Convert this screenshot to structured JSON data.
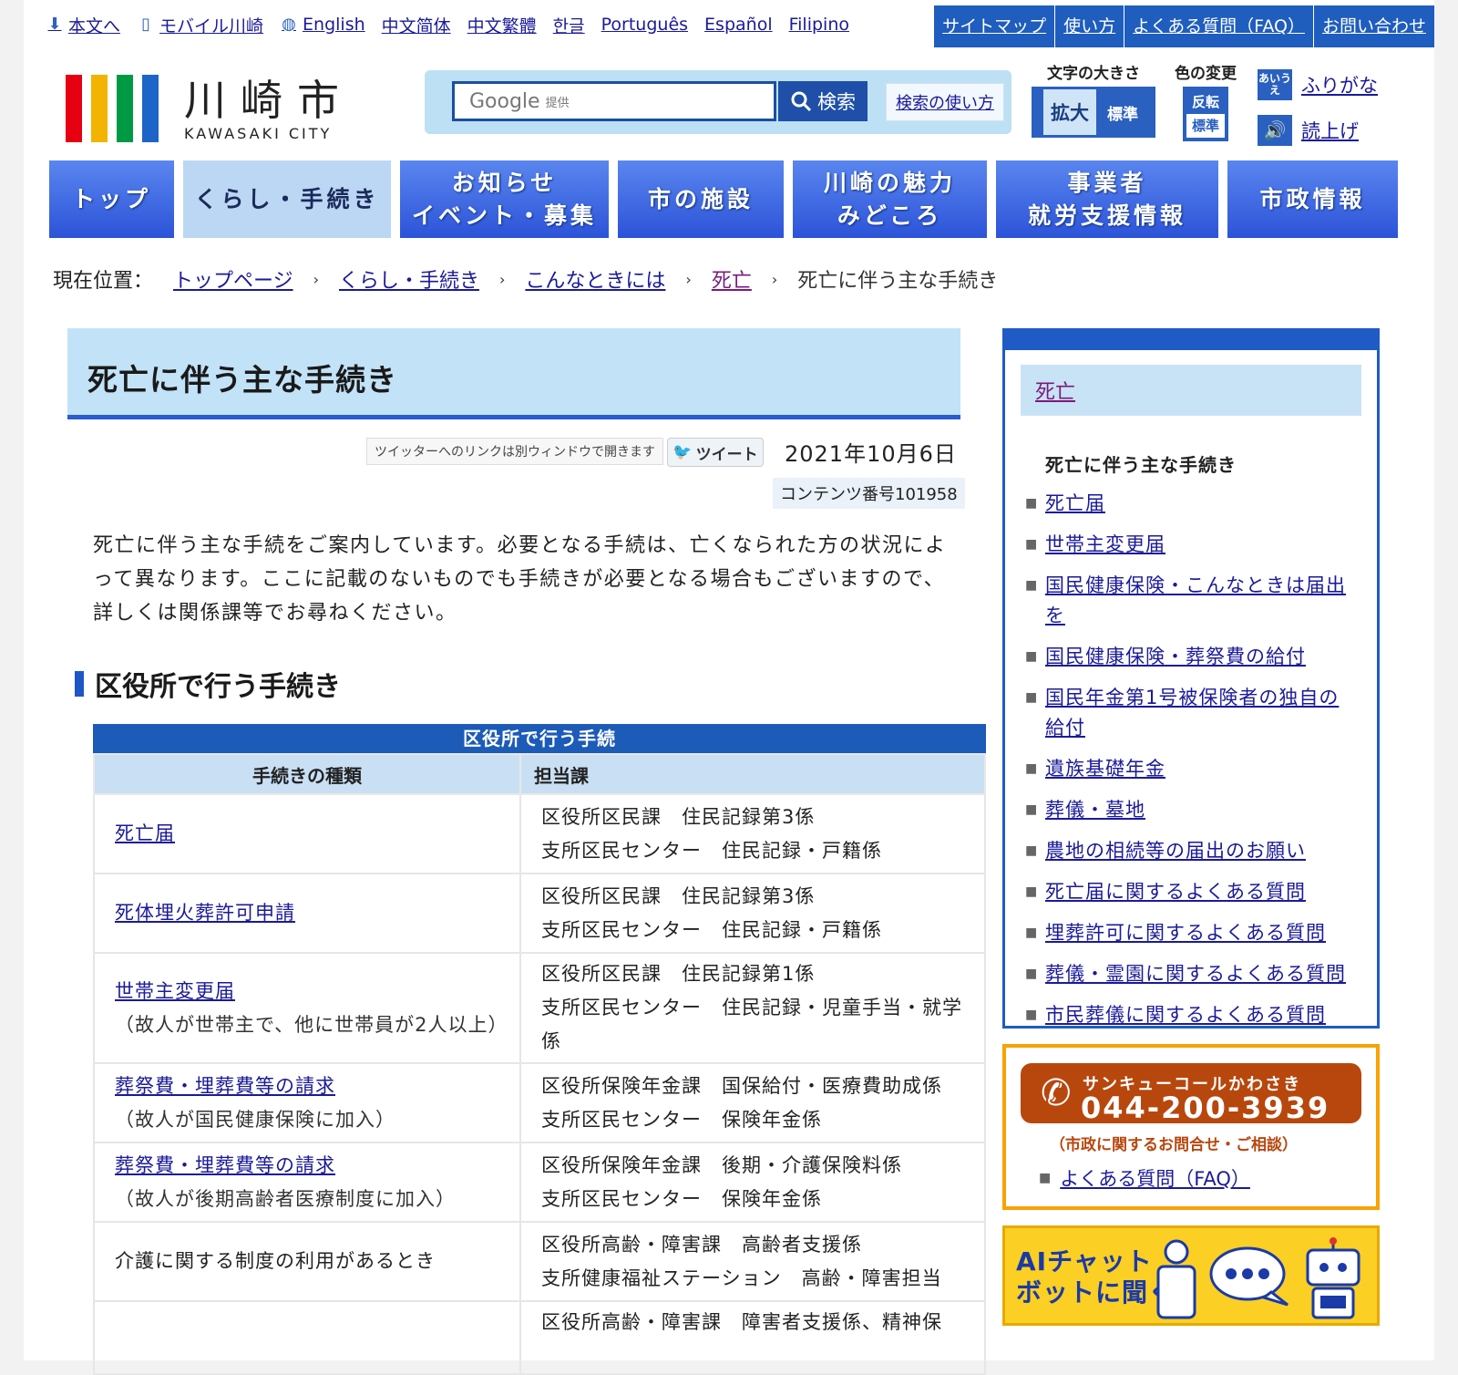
{
  "utility": {
    "items": [
      {
        "label": "本文へ",
        "icon": "download-arrow-icon"
      },
      {
        "label": "モバイル川崎",
        "icon": "mobile-icon"
      },
      {
        "label": "English",
        "icon": "globe-icon"
      },
      {
        "label": "中文简体"
      },
      {
        "label": "中文繁體"
      },
      {
        "label": "한글"
      },
      {
        "label": "Português"
      },
      {
        "label": "Español"
      },
      {
        "label": "Filipino"
      }
    ],
    "topnav": [
      "サイトマップ",
      "使い方",
      "よくある質問（FAQ）",
      "お問い合わせ"
    ]
  },
  "logo": {
    "jp": "川崎市",
    "en": "KAWASAKI CITY",
    "colors": [
      "#e60012",
      "#f2b400",
      "#009a44",
      "#1d64c8"
    ]
  },
  "search": {
    "google": "Google",
    "google_sub": "提供",
    "button": "検索",
    "help": "検索の使い方"
  },
  "accessibility": {
    "font_title": "文字の大きさ",
    "font_big": "拡大",
    "font_std": "標準",
    "color_title": "色の変更",
    "color_invert": "反転",
    "color_std": "標準",
    "ruby_icon": "あいうえ",
    "ruby": "ふりがな",
    "reader": "読上げ"
  },
  "globalnav": [
    {
      "label": "トップ"
    },
    {
      "label": "くらし・手続き",
      "active": true
    },
    {
      "label": "お知らせ\nイベント・募集"
    },
    {
      "label": "市の施設"
    },
    {
      "label": "川崎の魅力\nみどころ"
    },
    {
      "label": "事業者\n就労支援情報"
    },
    {
      "label": "市政情報"
    }
  ],
  "breadcrumb": {
    "prefix": "現在位置：",
    "links": [
      "トップページ",
      "くらし・手続き",
      "こんなときには",
      "死亡"
    ],
    "current": "死亡に伴う主な手続き"
  },
  "main": {
    "title": "死亡に伴う主な手続き",
    "tweet_note": "ツイッターへのリンクは別ウィンドウで開きます",
    "tweet_button": "ツイート",
    "date": "2021年10月6日",
    "content_no": "コンテンツ番号101958",
    "intro": "死亡に伴う主な手続をご案内しています。必要となる手続は、亡くなられた方の状況によって異なります。ここに記載のないものでも手続きが必要となる場合もございますので、詳しくは関係課等でお尋ねください。",
    "section_title": "区役所で行う手続き",
    "table": {
      "caption": "区役所で行う手続",
      "headers": [
        "手続きの種類",
        "担当課"
      ],
      "rows": [
        {
          "link": "死亡届",
          "note": "",
          "dept1": "区役所区民課　住民記録第3係",
          "dept2": "支所区民センター　住民記録・戸籍係"
        },
        {
          "link": "死体埋火葬許可申請",
          "note": "",
          "dept1": "区役所区民課　住民記録第3係",
          "dept2": "支所区民センター　住民記録・戸籍係"
        },
        {
          "link": "世帯主変更届",
          "note": "（故人が世帯主で、他に世帯員が2人以上）",
          "dept1": "区役所区民課　住民記録第1係",
          "dept2": "支所区民センター　住民記録・児童手当・就学係"
        },
        {
          "link": "葬祭費・埋葬費等の請求",
          "note": "（故人が国民健康保険に加入）",
          "dept1": "区役所保険年金課　国保給付・医療費助成係",
          "dept2": "支所区民センター　保険年金係"
        },
        {
          "link": "葬祭費・埋葬費等の請求",
          "note": "（故人が後期高齢者医療制度に加入）",
          "dept1": "区役所保険年金課　後期・介護保険料係",
          "dept2": "支所区民センター　保険年金係"
        },
        {
          "link": "",
          "note": "介護に関する制度の利用があるとき",
          "dept1": "区役所高齢・障害課　高齢者支援係",
          "dept2": "支所健康福祉ステーション　高齢・障害担当"
        },
        {
          "link": "",
          "note": "",
          "dept1": "区役所高齢・障害課　障害者支援係、精神保",
          "dept2": ""
        }
      ]
    }
  },
  "sidebar": {
    "heading": "死亡",
    "current": "死亡に伴う主な手続き",
    "links": [
      "死亡届",
      "世帯主変更届",
      "国民健康保険・こんなときは届出を",
      "国民健康保険・葬祭費の給付",
      "国民年金第1号被保険者の独自の給付",
      "遺族基礎年金",
      "葬儀・墓地",
      "農地の相続等の届出のお願い",
      "死亡届に関するよくある質問",
      "埋葬許可に関するよくある質問",
      "葬儀・霊園に関するよくある質問",
      "市民葬儀に関するよくある質問"
    ],
    "call": {
      "name": "サンキューコールかわさき",
      "number": "044-200-3939",
      "sub": "（市政に関するお問合せ・ご相談）",
      "faq": "よくある質問（FAQ）"
    },
    "ai": {
      "text": "AIチャット\nボットに聞く"
    }
  }
}
